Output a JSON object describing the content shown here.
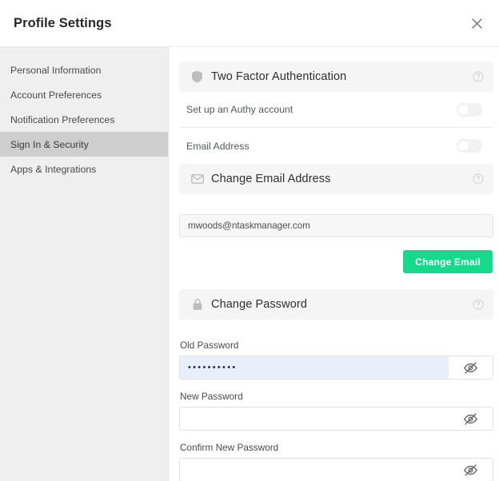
{
  "header": {
    "title": "Profile Settings",
    "close_label": "Close",
    "close_icon": "close-icon"
  },
  "sidebar": {
    "items": [
      {
        "label": "Personal Information",
        "active": false
      },
      {
        "label": "Account Preferences",
        "active": false
      },
      {
        "label": "Notification Preferences",
        "active": false
      },
      {
        "label": "Sign In & Security",
        "active": true
      },
      {
        "label": "Apps & Integrations",
        "active": false
      }
    ]
  },
  "main": {
    "two_factor": {
      "section_title": "Two Factor Authentication",
      "section_icon": "shield-icon",
      "help_icon": "help-circle-icon",
      "rows": [
        {
          "label": "Set up an Authy account",
          "enabled": false
        },
        {
          "label": "Email Address",
          "enabled": false
        }
      ]
    },
    "change_email": {
      "section_title": "Change Email Address",
      "section_icon": "envelope-icon",
      "help_icon": "help-circle-icon",
      "email_value": "mwoods@ntaskmanager.com",
      "email_placeholder": "Email Address",
      "button_label": "Change Email"
    },
    "change_password": {
      "section_title": "Change Password",
      "section_icon": "lock-icon",
      "help_icon": "help-circle-icon",
      "fields": [
        {
          "label": "Old Password",
          "value": "••••••••••",
          "placeholder": "Old Password",
          "filled": true,
          "toggle_icon": "eye-off-icon"
        },
        {
          "label": "New Password",
          "value": "",
          "placeholder": "",
          "filled": false,
          "toggle_icon": "eye-off-icon"
        },
        {
          "label": "Confirm New Password",
          "value": "",
          "placeholder": "",
          "filled": false,
          "toggle_icon": "eye-off-icon"
        }
      ]
    }
  },
  "colors": {
    "accent_green": "#16d98c",
    "sidebar_bg": "#efefef",
    "sidebar_active_bg": "#cecece",
    "section_bg": "#f5f5f5",
    "autofill_blue": "#e8eefb"
  }
}
